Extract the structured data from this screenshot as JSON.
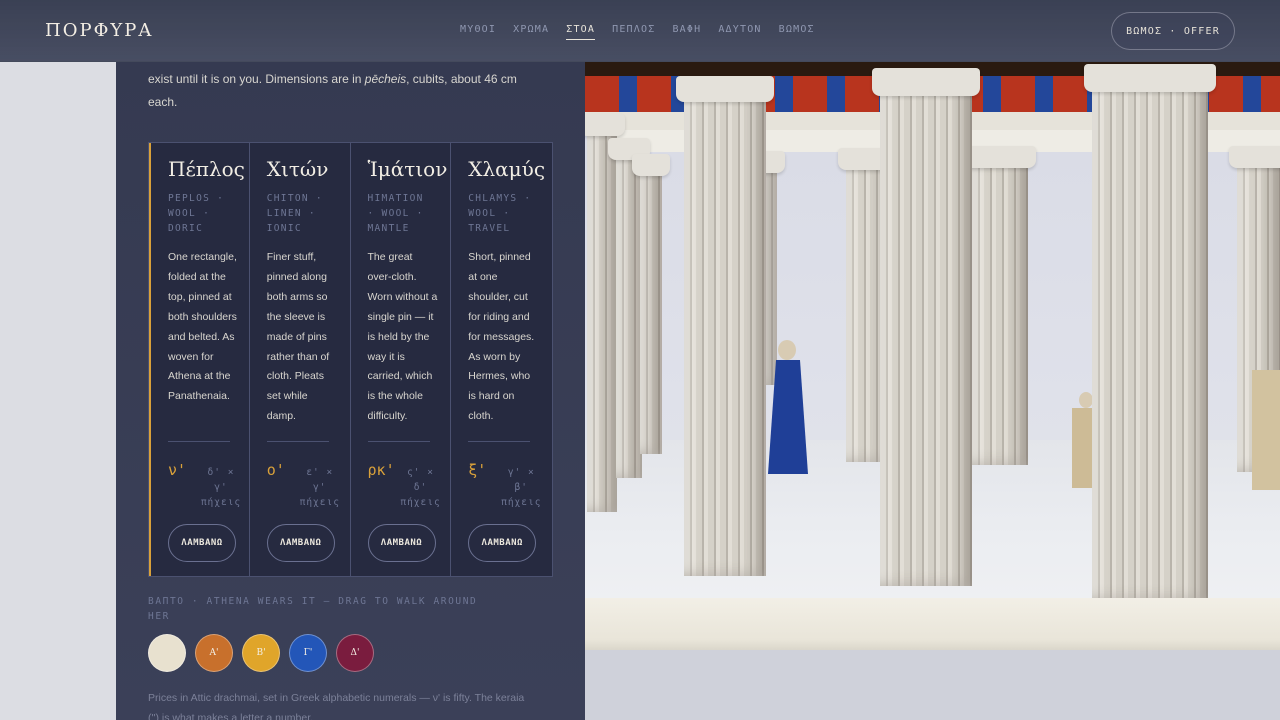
{
  "brand": {
    "name": "ΠΟΡΦΥΡΑ"
  },
  "nav": {
    "items": [
      {
        "label": "ΜΥΘΟΙ"
      },
      {
        "label": "ΧΡΩΜΑ"
      },
      {
        "label": "ΣΤΟΑ",
        "active": true
      },
      {
        "label": "ΠΕΠΛΟΣ"
      },
      {
        "label": "ΒΑΦΗ"
      },
      {
        "label": "ΑΔΥΤΟΝ"
      },
      {
        "label": "ΒΩΜΟΣ"
      }
    ],
    "offer_label": "ΒΩΜΟΣ · OFFER"
  },
  "intro": {
    "line1": "exist until it is on you. Dimensions are in ",
    "term": "pēcheis",
    "line2": ", cubits, about 46 cm each."
  },
  "garments": [
    {
      "name": "Πέπλος",
      "meta": "PEPLOS · WOOL · DORIC",
      "desc": "One rectangle, folded at the top, pinned at both shoulders and belted. As woven for Athena at the Panathenaia.",
      "price": "ν'",
      "size": "δ' × γ' πήχεις",
      "action": "ΛΑΜΒΑΝΩ",
      "selected": true
    },
    {
      "name": "Χιτών",
      "meta": "CHITON · LINEN · IONIC",
      "desc": "Finer stuff, pinned along both arms so the sleeve is made of pins rather than of cloth. Pleats set while damp.",
      "price": "ο'",
      "size": "ε' × γ' πήχεις",
      "action": "ΛΑΜΒΑΝΩ",
      "selected": false
    },
    {
      "name": "Ἱμάτιον",
      "meta": "HIMATION · WOOL · MANTLE",
      "desc": "The great over-cloth. Worn without a single pin — it is held by the way it is carried, which is the whole difficulty.",
      "price": "ρκ'",
      "size": "ς' × δ' πήχεις",
      "action": "ΛΑΜΒΑΝΩ",
      "selected": false
    },
    {
      "name": "Χλαμύς",
      "meta": "CHLAMYS · WOOL · TRAVEL",
      "desc": "Short, pinned at one shoulder, cut for riding and for messages. As worn by Hermes, who is hard on cloth.",
      "price": "ξ'",
      "size": "γ' × β' πήχεις",
      "action": "ΛΑΜΒΑΝΩ",
      "selected": false
    }
  ],
  "dye": {
    "label": "ΒΑΠΤΟ · ATHENA WEARS IT — DRAG TO WALK AROUND HER",
    "swatches": [
      {
        "label": "",
        "color": "#e8e1cf"
      },
      {
        "label": "Α'",
        "color": "#c8702c"
      },
      {
        "label": "Β'",
        "color": "#e0a52a"
      },
      {
        "label": "Γ'",
        "color": "#2356b8"
      },
      {
        "label": "Δ'",
        "color": "#7a1c3e"
      }
    ]
  },
  "footnote": "Prices in Attic drachmai, set in Greek alphabetic numerals — ν' is fifty. The keraia ('') is what makes a letter a number.",
  "colors": {
    "accent": "#d9a13a",
    "panel": "#353a51",
    "card": "#262a40"
  }
}
